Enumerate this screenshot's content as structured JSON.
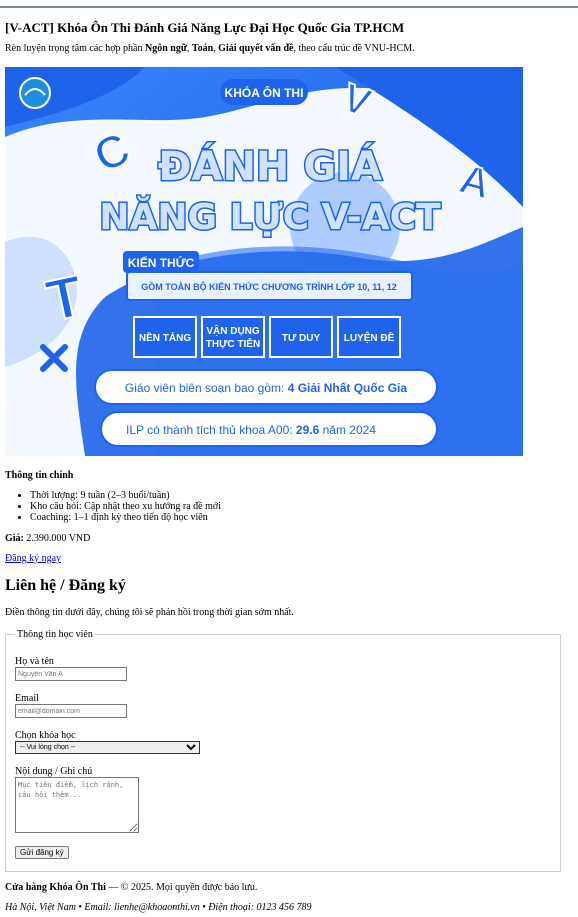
{
  "page": {
    "title": "[V-ACT] Khóa Ôn Thi Đánh Giá Năng Lực Đại Học Quốc Gia TP.HCM",
    "intro_prefix": "Rèn luyện trọng tâm các hợp phần ",
    "intro_b1": "Ngôn ngữ",
    "intro_sep1": ", ",
    "intro_b2": "Toán",
    "intro_sep2": ", ",
    "intro_b3": "Giải quyết vấn đề",
    "intro_suffix": ", theo cấu trúc đề VNU-HCM."
  },
  "banner": {
    "badge": "KHÓA ÔN THI",
    "headline1": "ĐÁNH GIÁ",
    "headline2": "NĂNG LỰC V-ACT",
    "knowledge_label": "KIẾN THỨC",
    "knowledge_text": "GỒM TOÀN BỘ KIẾN THỨC CHƯƠNG TRÌNH LỚP 10, 11, 12",
    "box1": "NỀN TẢNG",
    "box2a": "VẬN DỤNG",
    "box2b": "THỰC TIỄN",
    "box3": "TƯ DUY",
    "box4": "LUYỆN ĐỀ",
    "pill1_normal": "Giáo viên biên soạn bao gồm: ",
    "pill1_bold": "4 Giải Nhất Quốc Gia",
    "pill2_a": "ILP có thành tích thủ khoa A00: ",
    "pill2_b": "29.6",
    "pill2_c": " năm 2024",
    "letters": [
      "C",
      "V",
      "A",
      "T"
    ],
    "colors": {
      "primary": "#1e63e9",
      "dark": "#0b3fb8",
      "light": "#eaf2ff",
      "accent": "#2f7bff"
    }
  },
  "info": {
    "heading": "Thông tin chính",
    "items": [
      "Thời lượng: 9 tuần (2–3 buổi/tuần)",
      "Kho câu hỏi: Cập nhật theo xu hướng ra đề mới",
      "Coaching: 1–1 định kỳ theo tiến độ học viên"
    ],
    "price_label": "Giá:",
    "price_value": " 2.390.000 VND",
    "register_link": "Đăng ký ngay"
  },
  "contact": {
    "heading": "Liên hệ / Đăng ký",
    "desc": "Điền thông tin dưới đây, chúng tôi sẽ phản hồi trong thời gian sớm nhất.",
    "legend": "Thông tin học viên",
    "name_label": "Họ và tên",
    "name_placeholder": "Nguyễn Văn A",
    "email_label": "Email",
    "email_placeholder": "email@domain.com",
    "course_label": "Chọn khóa học",
    "course_selected": "-- Vui lòng chọn --",
    "note_label": "Nội dung / Ghi chú",
    "note_placeholder": "Mục tiêu điểm, lịch rảnh, câu hỏi thêm...",
    "submit": "Gửi đăng ký"
  },
  "footer": {
    "brand": "Cửa hàng Khóa Ôn Thi",
    "copy": " — © 2025. Mọi quyền được bảo lưu.",
    "address": "Hà Nội, Việt Nam • Email: lienhe@khoaonthi.vn • Điện thoại: 0123 456 789"
  }
}
